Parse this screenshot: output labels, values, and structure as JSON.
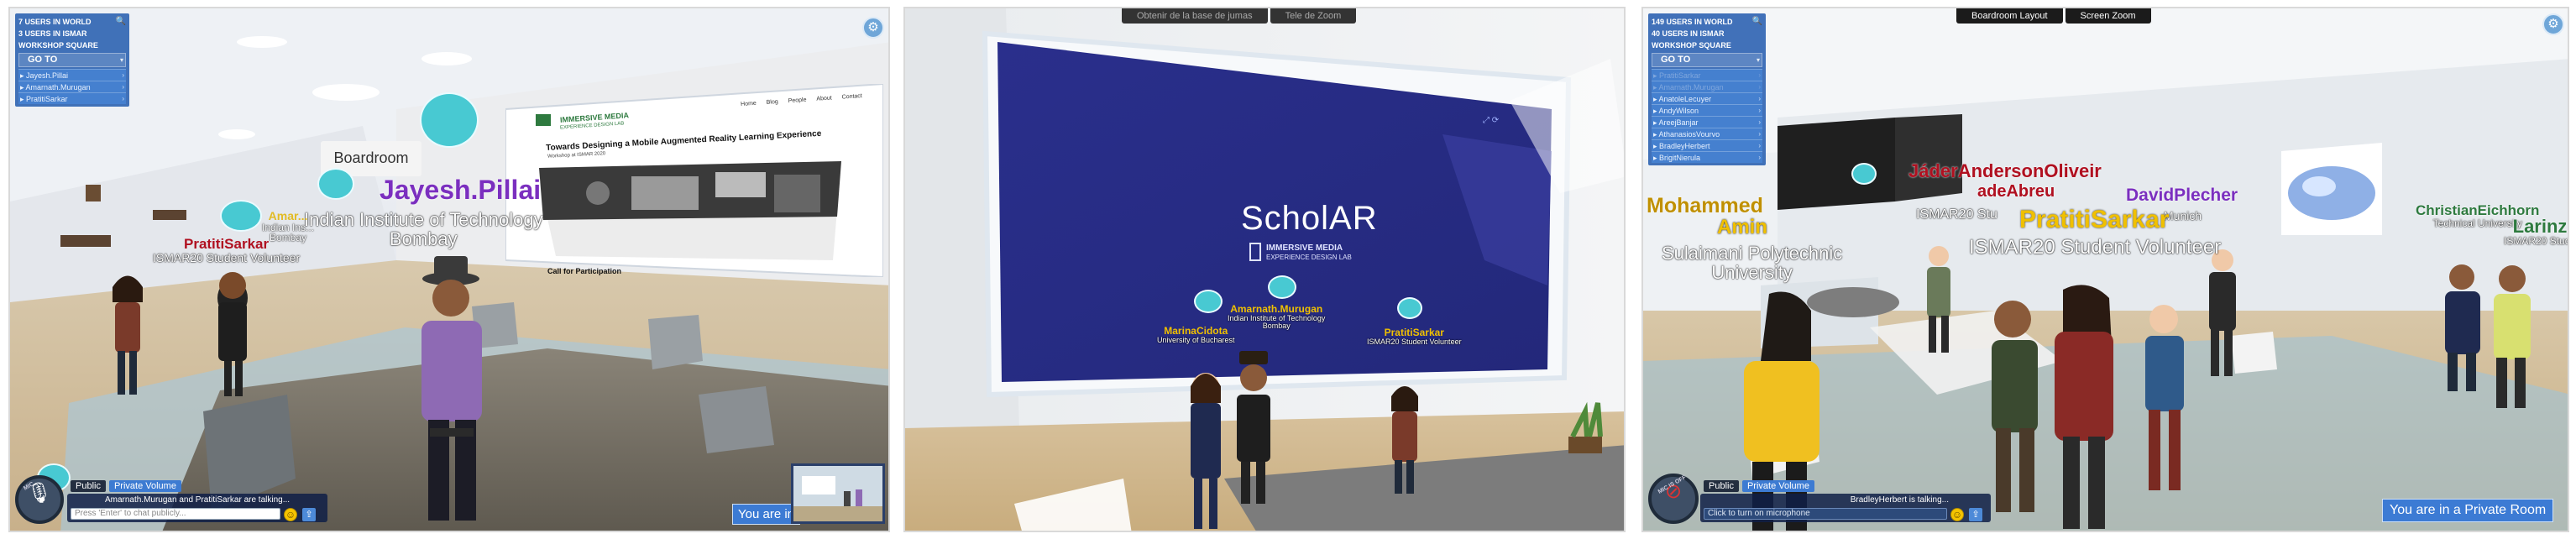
{
  "colors": {
    "accent": "#3c7bd4",
    "panel": "#2f62b0",
    "bubble": "#48c9d2",
    "name_purple": "#7b2fbf",
    "name_red": "#b01020",
    "name_yellow": "#f0c000"
  },
  "icons": {
    "search": "search-icon",
    "gear": "gear-icon",
    "mic": "microphone-icon",
    "emoji": "smiley-icon",
    "share": "share-icon"
  },
  "panel1": {
    "users": {
      "count": "7 USERS IN WORLD",
      "room_count": "3 USERS IN ISMAR",
      "room": "WORKSHOP SQUARE",
      "goto": "GO TO",
      "items": [
        "Jayesh.Pillai",
        "Amarnath.Murugan",
        "PratitiSarkar"
      ]
    },
    "room_sign": "Boardroom",
    "screen": {
      "logo_title": "IMMERSIVE MEDIA",
      "logo_sub": "EXPERIENCE DESIGN LAB",
      "nav": [
        "Home",
        "Blog",
        "People",
        "About",
        "Contact"
      ],
      "headline": "Towards Designing a Mobile Augmented Reality Learning Experience",
      "subline": "Workshop at ISMAR 2020",
      "cta": "Call for Participation"
    },
    "tags": {
      "jayesh": {
        "name": "Jayesh.Pillai",
        "aff1": "Indian Institute of Technology",
        "aff2": "Bombay"
      },
      "pratiti": {
        "name": "PratitiSarkar",
        "aff": "ISMAR20 Student Volunteer"
      },
      "amar": {
        "name": "Amar...",
        "aff1": "Indian Ins...",
        "aff2": "Bombay"
      }
    },
    "chat": {
      "mic_label": "MIC",
      "tab_public": "Public",
      "tab_private": "Private Volume",
      "talking": "Amarnath.Murugan and PratitiSarkar are talking...",
      "placeholder": "Press 'Enter' to chat publicly..."
    },
    "private_label": "You are in"
  },
  "panel2": {
    "toptabs": [
      "Obtenir de la base de jumas",
      "Tele de Zoom"
    ],
    "screen": {
      "brand": "ScholAR",
      "lab1": "IMMERSIVE MEDIA",
      "lab2": "EXPERIENCE DESIGN LAB"
    },
    "tags": [
      {
        "name": "MarinaCidota",
        "aff1": "University of Bucharest",
        "aff2": ""
      },
      {
        "name": "Amarnath.Murugan",
        "aff1": "Indian Institute of Technology",
        "aff2": "Bombay"
      },
      {
        "name": "PratitiSarkar",
        "aff1": "ISMAR20 Student Volunteer",
        "aff2": ""
      }
    ]
  },
  "panel3": {
    "toptabs": [
      "Boardroom Layout",
      "Screen Zoom"
    ],
    "users": {
      "count": "149 USERS IN WORLD",
      "room_count": "40 USERS IN ISMAR",
      "room": "WORKSHOP SQUARE",
      "goto": "GO TO",
      "items": [
        "PratitiSarkar",
        "Amarnath.Murugan",
        "AnatoleLecuyer",
        "AndyWilson",
        "AreejBanjar",
        "AthanasiosVourvo",
        "BradleyHerbert",
        "BrigitNierula"
      ]
    },
    "tags": {
      "jader": {
        "name": "JáderAndersonOliveir",
        "aff": ""
      },
      "ade": {
        "name": "adeAbreu",
        "aff": "ISMAR20 Stu"
      },
      "david": {
        "name": "DavidPlecher",
        "aff": "Munich"
      },
      "mohammed": {
        "name": "Mohammed",
        "aff": "Amin"
      },
      "sulaimani": {
        "name": "Sulaimani Polytechnic",
        "aff": "University"
      },
      "pratiti": {
        "name": "PratitiSarkar",
        "aff": "ISMAR20 Student Volunteer"
      },
      "christian": {
        "name": "ChristianEichhorn",
        "aff": "Technical University"
      },
      "larinz": {
        "name": "Larinz",
        "aff": "ISMAR20 Stude"
      }
    },
    "chat": {
      "mic_label": "MIC IS OFF",
      "tab_public": "Public",
      "tab_private": "Private Volume",
      "talking": "BradleyHerbert is talking...",
      "placeholder": "Click to turn on microphone"
    },
    "private_label": "You are in a Private Room"
  }
}
